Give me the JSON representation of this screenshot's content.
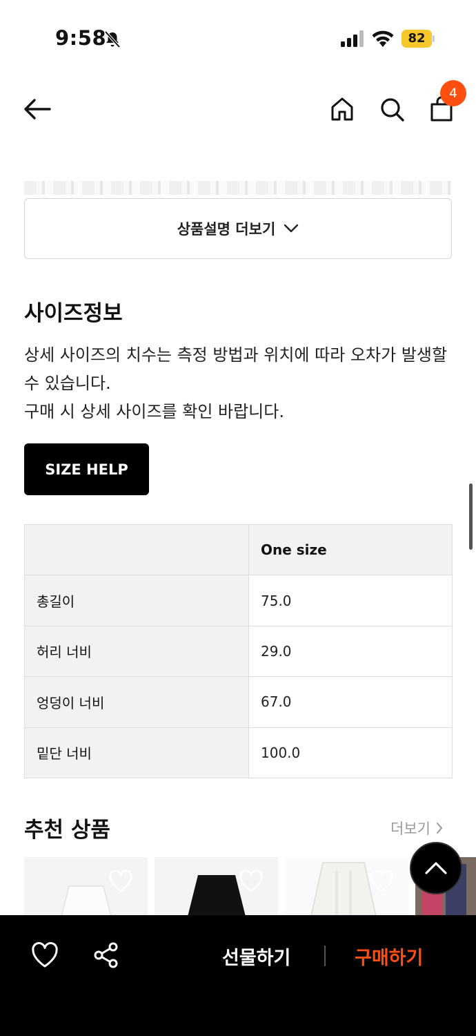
{
  "status": {
    "time": "9:58",
    "battery": "82"
  },
  "nav": {
    "cart_count": "4"
  },
  "product_description": {
    "more_label": "상품설명 더보기"
  },
  "size_info": {
    "title": "사이즈정보",
    "note_line1": "상세 사이즈의 치수는 측정 방법과 위치에 따라 오차가 발생할 수 있습니다.",
    "note_line2": "구매 시 상세 사이즈를 확인 바랍니다.",
    "help_button": "SIZE HELP",
    "table": {
      "header": [
        "",
        "One size"
      ],
      "rows": [
        {
          "label": "총길이",
          "value": "75.0"
        },
        {
          "label": "허리 너비",
          "value": "29.0"
        },
        {
          "label": "엉덩이 너비",
          "value": "67.0"
        },
        {
          "label": "밑단 너비",
          "value": "100.0"
        }
      ]
    }
  },
  "recommended": {
    "title": "추천 상품",
    "more_label": "더보기"
  },
  "bottom_bar": {
    "gift_label": "선물하기",
    "buy_label": "구매하기"
  },
  "colors": {
    "accent": "#ff4f10",
    "battery": "#f6c82b",
    "bottom_bar": "#000000"
  },
  "icons": [
    "bell-off-icon",
    "signal-icon",
    "wifi-icon",
    "battery-icon",
    "back-arrow-icon",
    "home-icon",
    "search-icon",
    "cart-icon",
    "chevron-down-icon",
    "chevron-right-icon",
    "heart-icon",
    "arrow-up-icon",
    "share-icon"
  ]
}
